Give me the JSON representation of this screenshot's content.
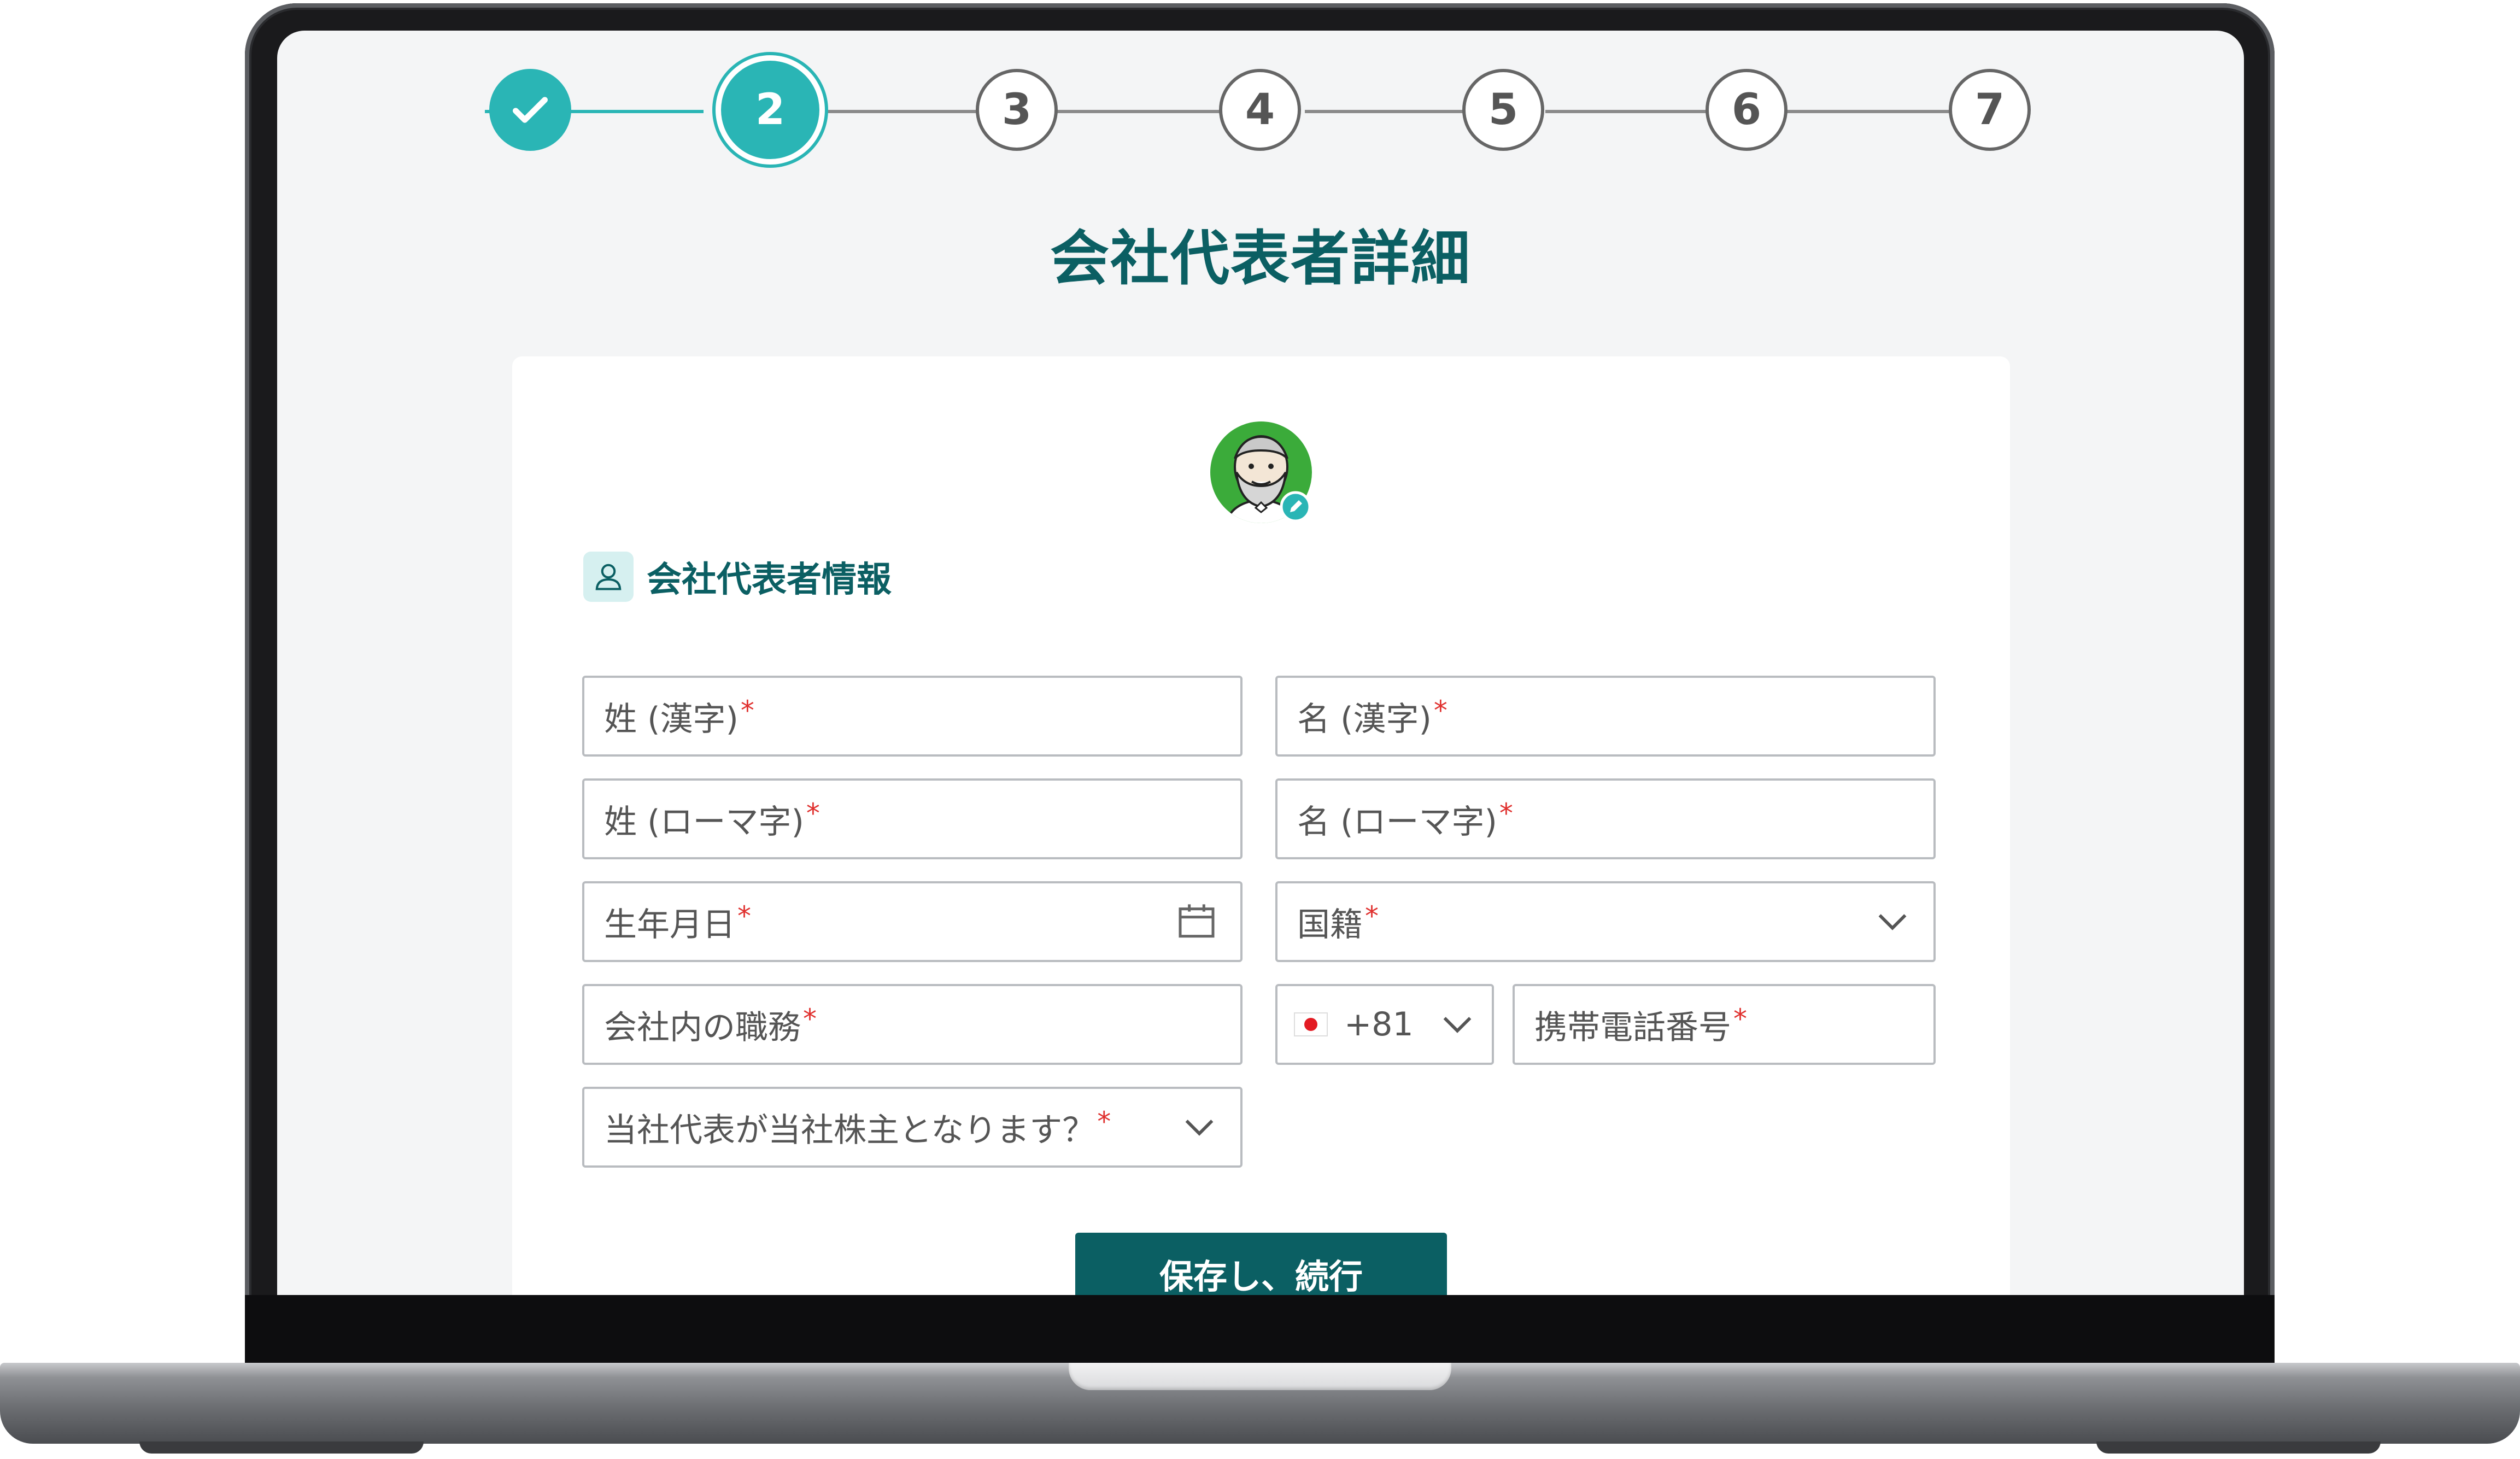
{
  "stepper": {
    "steps": [
      {
        "label": "",
        "state": "done",
        "icon": "check-icon"
      },
      {
        "label": "2",
        "state": "active"
      },
      {
        "label": "3",
        "state": "pending"
      },
      {
        "label": "4",
        "state": "pending"
      },
      {
        "label": "5",
        "state": "pending"
      },
      {
        "label": "6",
        "state": "pending"
      },
      {
        "label": "7",
        "state": "pending"
      }
    ]
  },
  "page_title": "会社代表者詳細",
  "section": {
    "title": "会社代表者情報",
    "icon": "user-icon"
  },
  "avatar": {
    "icon": "bearded-man-avatar",
    "edit_icon": "pencil-icon"
  },
  "form": {
    "last_name_kanji": "姓 (漢字)",
    "first_name_kanji": "名 (漢字)",
    "last_name_roman": "姓 (ローマ字)",
    "first_name_roman": "名 (ローマ字)",
    "birth_date": "生年月日",
    "nationality": "国籍",
    "job_title": "会社内の職務",
    "phone_code": "+81",
    "mobile_phone": "携帯電話番号",
    "shareholder_question": "当社代表が当社株主となります？",
    "required_mark": "*"
  },
  "buttons": {
    "save_continue": "保存し、続行"
  },
  "colors": {
    "accent": "#2ab5b5",
    "primary_dark": "#0b5f63",
    "required": "#e0312f",
    "background": "#f4f5f6"
  }
}
